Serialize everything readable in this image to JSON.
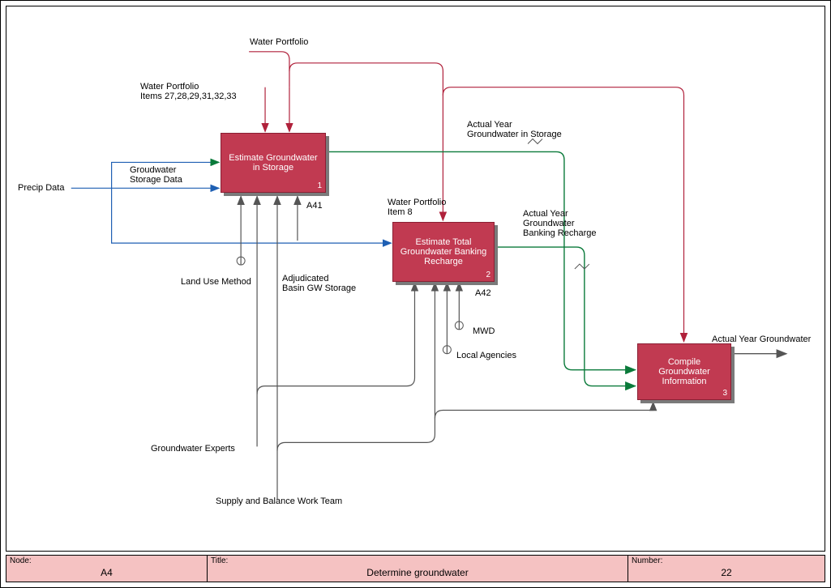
{
  "footer": {
    "node_label": "Node:",
    "node_value": "A4",
    "title_label": "Title:",
    "title_value": "Determine groundwater",
    "number_label": "Number:",
    "number_value": "22"
  },
  "nodes": {
    "a41": {
      "title": "Estimate Groundwater in Storage",
      "num": "1",
      "id": "A41"
    },
    "a42": {
      "title": "Estimate Total Groundwater Banking Recharge",
      "num": "2",
      "id": "A42"
    },
    "a43": {
      "title": "Compile Groundwater Information",
      "num": "3"
    }
  },
  "labels": {
    "water_portfolio_top": "Water Portfolio",
    "water_portfolio_items": "Water Portfolio\nItems 27,28,29,31,32,33",
    "groundwater_storage_data": "Groudwater\nStorage Data",
    "precip_data": "Precip Data",
    "land_use_method": "Land Use Method",
    "adjudicated_basin": "Adjudicated\nBasin GW Storage",
    "water_portfolio_item8": "Water Portfolio\nItem 8",
    "mwd": "MWD",
    "local_agencies": "Local Agencies",
    "groundwater_experts": "Groundwater Experts",
    "supply_team": "Supply and Balance Work Team",
    "actual_year_storage": "Actual Year\nGroundwater in Storage",
    "actual_year_recharge": "Actual Year\nGroundwater\nBanking Recharge",
    "actual_year_groundwater": "Actual Year Groundwater"
  },
  "colors": {
    "red": "#c13a51",
    "blue": "#1e5fb3",
    "green": "#0a7a3a",
    "darkred": "#b0213b",
    "gray": "#555"
  }
}
